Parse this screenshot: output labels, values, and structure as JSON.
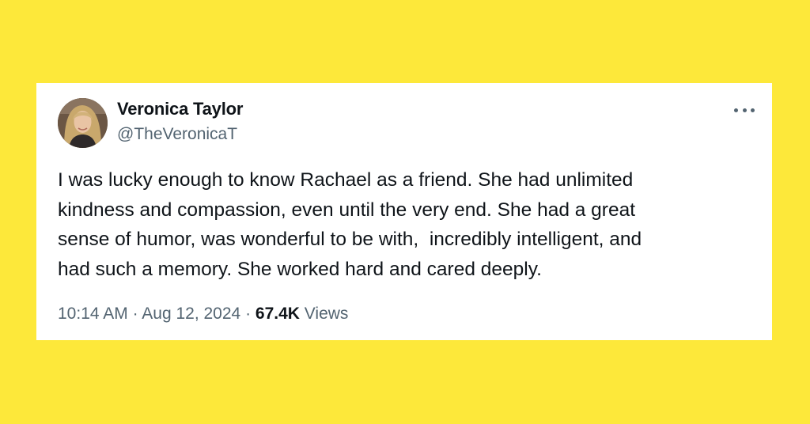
{
  "colors": {
    "background": "#fde83a",
    "card": "#ffffff",
    "primary_text": "#0f1419",
    "secondary_text": "#536471"
  },
  "author": {
    "display_name": "Veronica Taylor",
    "handle": "@TheVeronicaT",
    "avatar_icon": "profile-photo"
  },
  "more_icon": "ellipsis-horizontal-icon",
  "tweet": {
    "text": "I was lucky enough to know Rachael as a friend. She had unlimited\nkindness and compassion, even until the very end. She had a great\nsense of humor, was wonderful to be with,  incredibly intelligent, and\nhad such a memory. She worked hard and cared deeply."
  },
  "meta": {
    "time": "10:14 AM",
    "separator": "·",
    "date": "Aug 12, 2024",
    "views_count": "67.4K",
    "views_label": "Views"
  }
}
